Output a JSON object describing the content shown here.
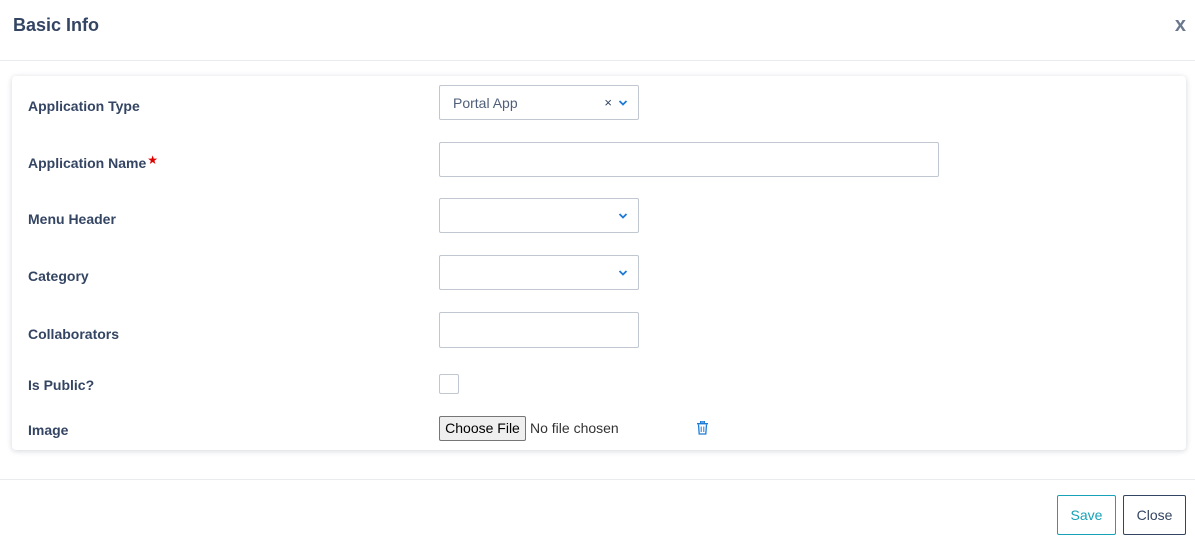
{
  "header": {
    "title": "Basic Info",
    "close_glyph": "x"
  },
  "form": {
    "application_type": {
      "label": "Application Type",
      "value": "Portal App",
      "clear_glyph": "×"
    },
    "application_name": {
      "label": "Application Name",
      "required_mark": "★",
      "value": ""
    },
    "menu_header": {
      "label": "Menu Header",
      "value": ""
    },
    "category": {
      "label": "Category",
      "value": ""
    },
    "collaborators": {
      "label": "Collaborators",
      "value": ""
    },
    "is_public": {
      "label": "Is Public?",
      "checked": false
    },
    "image": {
      "label": "Image",
      "button_label": "Choose File",
      "status": "No file chosen"
    }
  },
  "footer": {
    "save_label": "Save",
    "close_label": "Close"
  },
  "colors": {
    "accent": "#17a2b8",
    "text": "#344563",
    "required": "#e00000",
    "icon_blue": "#1e7bd6"
  },
  "icons": [
    "close-icon",
    "clear-icon",
    "chevron-down-icon",
    "trash-icon"
  ]
}
